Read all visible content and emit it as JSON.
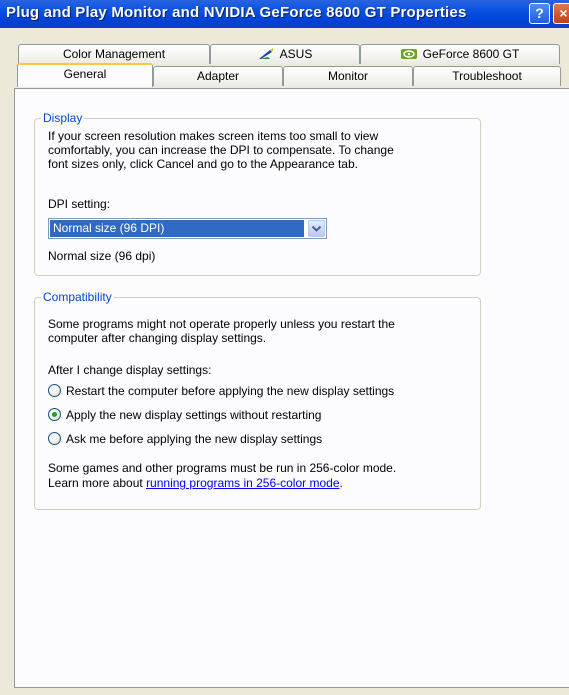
{
  "window": {
    "title": "Plug and Play Monitor and NVIDIA GeForce 8600 GT Properties",
    "help_label": "?",
    "close_label": "×"
  },
  "tabs": {
    "row1": [
      {
        "label": "Color Management",
        "icon": ""
      },
      {
        "label": "ASUS",
        "icon": "asus-icon"
      },
      {
        "label": "GeForce 8600 GT",
        "icon": "nvidia-icon"
      }
    ],
    "row2": [
      {
        "label": "General",
        "active": true
      },
      {
        "label": "Adapter"
      },
      {
        "label": "Monitor"
      },
      {
        "label": "Troubleshoot"
      }
    ]
  },
  "display": {
    "group_title": "Display",
    "description_lines": [
      "If your screen resolution makes screen items too small to view",
      "comfortably, you can increase the DPI to compensate.  To change",
      "font sizes only, click Cancel and go to the Appearance tab."
    ],
    "dpi_label": "DPI setting:",
    "dpi_selected": "Normal size (96 DPI)",
    "dpi_note": "Normal size (96 dpi)"
  },
  "compatibility": {
    "group_title": "Compatibility",
    "description_lines": [
      "Some programs might not operate properly unless you restart the",
      "computer after changing display settings."
    ],
    "after_change_label": "After I change display settings:",
    "options": [
      {
        "label": "Restart the computer before applying the new display settings",
        "checked": false
      },
      {
        "label": "Apply the new display settings without restarting",
        "checked": true
      },
      {
        "label": "Ask me before applying the new display settings",
        "checked": false
      }
    ],
    "footer_line1": "Some games and other programs must be run in 256-color mode.",
    "footer_line2_prefix": "Learn more about ",
    "footer_link": "running programs in 256-color mode",
    "footer_line2_suffix": "."
  },
  "colors": {
    "titlebar": "#0a54e3",
    "group_title": "#0046d5",
    "selection": "#316ac5",
    "active_tab_accent": "#ffc83c"
  }
}
